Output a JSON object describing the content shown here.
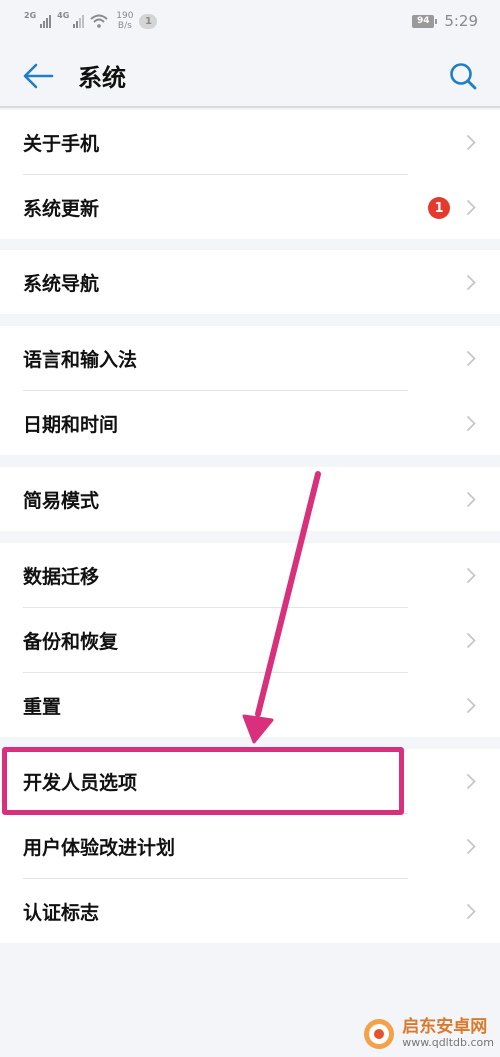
{
  "status_bar": {
    "net1": "2G",
    "net2": "4G",
    "speed_value": "190",
    "speed_unit": "B/s",
    "notification_count": "1",
    "battery": "94",
    "time": "5:29"
  },
  "header": {
    "title": "系统"
  },
  "groups": [
    {
      "items": [
        {
          "label": "关于手机"
        },
        {
          "label": "系统更新",
          "badge": "1"
        }
      ]
    },
    {
      "items": [
        {
          "label": "系统导航"
        }
      ]
    },
    {
      "items": [
        {
          "label": "语言和输入法"
        },
        {
          "label": "日期和时间"
        }
      ]
    },
    {
      "items": [
        {
          "label": "简易模式"
        }
      ]
    },
    {
      "items": [
        {
          "label": "数据迁移"
        },
        {
          "label": "备份和恢复"
        },
        {
          "label": "重置"
        }
      ]
    },
    {
      "items": [
        {
          "label": "开发人员选项"
        },
        {
          "label": "用户体验改进计划"
        },
        {
          "label": "认证标志"
        }
      ]
    }
  ],
  "annotation": {
    "highlight_color": "#d9307d"
  },
  "watermark": {
    "text": "启东安卓网",
    "url": "www.qdltdb.com"
  }
}
